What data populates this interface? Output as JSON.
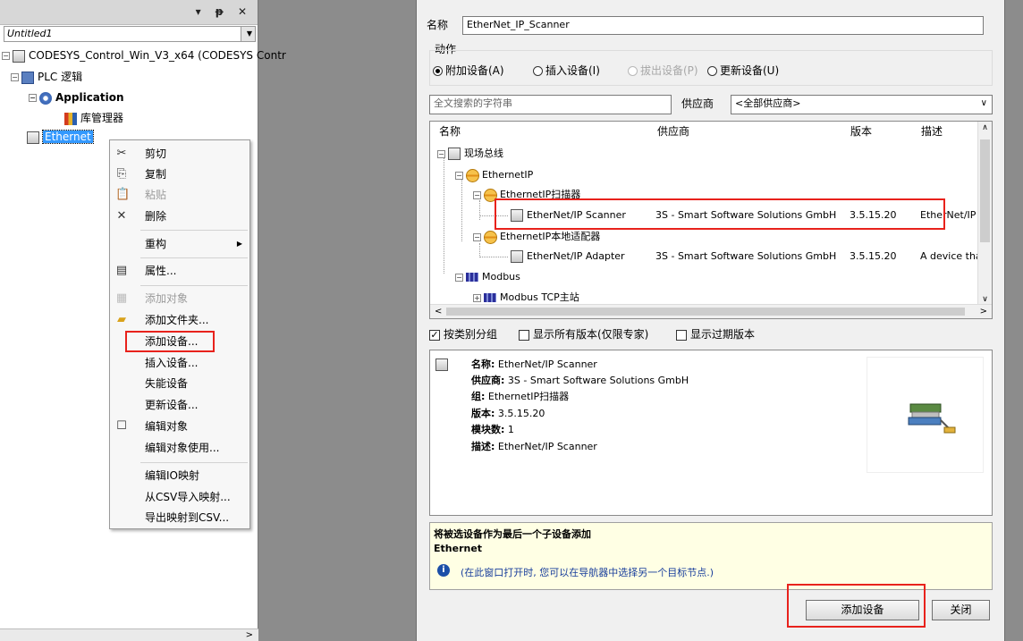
{
  "left_panel": {
    "title_icons": "▾ ᵽ ✕",
    "project_dropdown": "Untitled1",
    "tree": {
      "device": "CODESYS_Control_Win_V3_x64 (CODESYS Contr",
      "plc_logic": "PLC 逻辑",
      "application": "Application",
      "library_manager": "库管理器",
      "ethernet": "Ethernet"
    },
    "scroll_arrow": ">"
  },
  "context_menu": {
    "cut": "剪切",
    "copy": "复制",
    "paste": "粘贴",
    "delete": "删除",
    "refactor": "重构",
    "properties": "属性...",
    "add_object": "添加对象",
    "add_folder": "添加文件夹...",
    "add_device": "添加设备...",
    "insert_device": "插入设备...",
    "disable_device": "失能设备",
    "update_device": "更新设备...",
    "edit_object": "编辑对象",
    "edit_object_with": "编辑对象使用...",
    "edit_io_mapping": "编辑IO映射",
    "import_csv": "从CSV导入映射...",
    "export_csv": "导出映射到CSV..."
  },
  "dialog": {
    "name_label": "名称",
    "name_value": "EtherNet_IP_Scanner",
    "action_label": "动作",
    "radio_append": "附加设备(A)",
    "radio_insert": "插入设备(I)",
    "radio_plug": "拔出设备(P)",
    "radio_update": "更新设备(U)",
    "search_placeholder": "全文搜索的字符串",
    "vendor_label": "供应商",
    "vendor_value": "<全部供应商>",
    "columns": {
      "name": "名称",
      "vendor": "供应商",
      "version": "版本",
      "desc": "描述"
    },
    "rows": {
      "fieldbus": "现场总线",
      "ethernetip": "EthernetIP",
      "scanner_group": "EthernetIP扫描器",
      "scanner_name": "EtherNet/IP Scanner",
      "scanner_vendor": "3S - Smart Software Solutions GmbH",
      "scanner_version": "3.5.15.20",
      "scanner_desc": "EtherNet/IP",
      "adapter_group": "EthernetIP本地适配器",
      "adapter_name": "EtherNet/IP Adapter",
      "adapter_vendor": "3S - Smart Software Solutions GmbH",
      "adapter_version": "3.5.15.20",
      "adapter_desc": "A device tha",
      "modbus": "Modbus",
      "modbus_tcp": "Modbus TCP主站"
    },
    "opt_group": "按类别分组",
    "opt_all_versions": "显示所有版本(仅限专家)",
    "opt_outdated": "显示过期版本",
    "info": {
      "name_k": "名称:",
      "name_v": "EtherNet/IP Scanner",
      "vendor_k": "供应商:",
      "vendor_v": "3S - Smart Software Solutions GmbH",
      "group_k": "组:",
      "group_v": "EthernetIP扫描器",
      "version_k": "版本:",
      "version_v": "3.5.15.20",
      "modules_k": "模块数:",
      "modules_v": "1",
      "desc_k": "描述:",
      "desc_v": "EtherNet/IP Scanner"
    },
    "note_title": "将被选设备作为最后一个子设备添加",
    "note_target": "Ethernet",
    "note_hint": "(在此窗口打开时, 您可以在导航器中选择另一个目标节点.)",
    "btn_add": "添加设备",
    "btn_close": "关闭"
  },
  "colors": {
    "highlight": "#e8221c",
    "selection": "#3399ff",
    "note_bg": "#ffffe4"
  }
}
